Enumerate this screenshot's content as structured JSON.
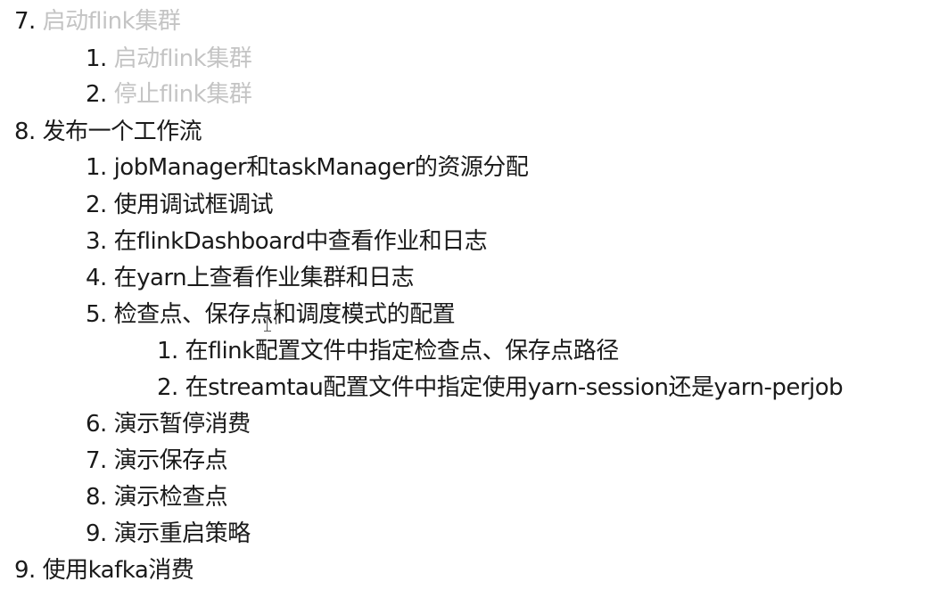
{
  "items": [
    {
      "num": "7.",
      "text": "启动flink集群"
    },
    {
      "num": "1.",
      "text": "启动flink集群"
    },
    {
      "num": "2.",
      "text": "停止flink集群"
    },
    {
      "num": "8.",
      "text": "发布一个工作流"
    },
    {
      "num": "1.",
      "text": "jobManager和taskManager的资源分配"
    },
    {
      "num": "2.",
      "text": "使用调试框调试"
    },
    {
      "num": "3.",
      "text": "在flinkDashboard中查看作业和日志"
    },
    {
      "num": "4.",
      "text": "在yarn上查看作业集群和日志"
    },
    {
      "num": "5.",
      "text": "检查点、保存点和调度模式的配置"
    },
    {
      "num": "1.",
      "text": "在flink配置文件中指定检查点、保存点路径"
    },
    {
      "num": "2.",
      "text": "在streamtau配置文件中指定使用yarn-session还是yarn-perjob"
    },
    {
      "num": "6.",
      "text": "演示暂停消费"
    },
    {
      "num": "7.",
      "text": "演示保存点"
    },
    {
      "num": "8.",
      "text": "演示检查点"
    },
    {
      "num": "9.",
      "text": "演示重启策略"
    },
    {
      "num": "9.",
      "text": "使用kafka消费"
    }
  ]
}
